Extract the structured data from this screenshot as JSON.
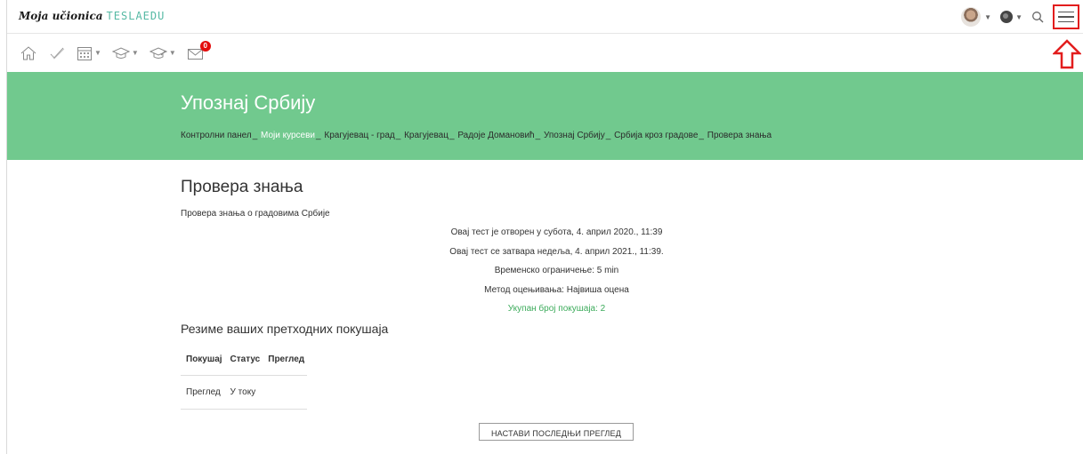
{
  "topbar": {
    "logo_script": "Moja učionica",
    "logo_brand": "TESLAEDU"
  },
  "iconbar": {
    "messages_badge": "0"
  },
  "header": {
    "course_title": "Упознај Србију",
    "breadcrumbs": [
      {
        "label": "Контролни панел",
        "muted": false
      },
      {
        "label": "Моји курсеви",
        "muted": true
      },
      {
        "label": "Крагујевац - град",
        "muted": false
      },
      {
        "label": "Крагујевац",
        "muted": false
      },
      {
        "label": "Радоје Домановић",
        "muted": false
      },
      {
        "label": "Упознај Србију",
        "muted": false
      },
      {
        "label": "Србија кроз градове",
        "muted": false
      },
      {
        "label": "Провера знања",
        "muted": false
      }
    ]
  },
  "quiz": {
    "title": "Провера знања",
    "description": "Провера знања о градовима Србије",
    "opened": "Овај тест је отворен у субота, 4. април 2020., 11:39",
    "closes": "Овај тест се затвара недеља, 4. април 2021., 11:39.",
    "time_limit": "Временско ограничење: 5 min",
    "grading_method": "Метод оцењивања: Највиша оцена",
    "attempts_total": "Укупан број покушаја: 2"
  },
  "summary": {
    "title": "Резиме ваших претходних покушаја",
    "columns": [
      "Покушај",
      "Статус",
      "Преглед"
    ],
    "rows": [
      [
        "Преглед",
        "У току",
        ""
      ]
    ]
  },
  "actions": {
    "continue_label": "НАСТАВИ ПОСЛЕДЊИ ПРЕГЛЕД"
  },
  "colors": {
    "header_bg": "#71c98e",
    "highlight": "#e21d1d",
    "green_text": "#3cab5b"
  }
}
